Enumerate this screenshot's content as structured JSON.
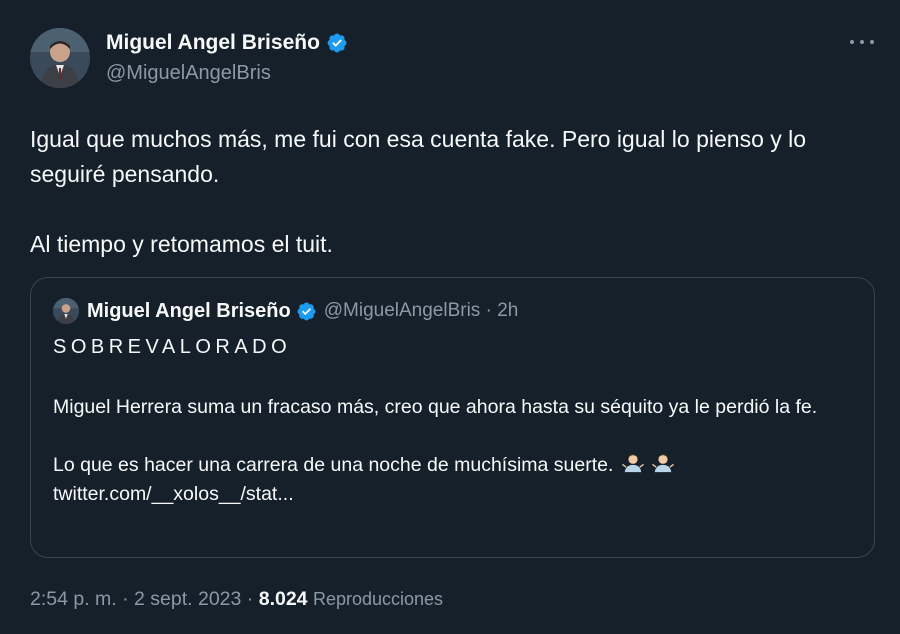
{
  "tweet": {
    "author": {
      "name": "Miguel Angel Briseño",
      "handle": "@MiguelAngelBris"
    },
    "text": {
      "line1": "Igual que muchos más, me fui con esa cuenta fake. Pero igual lo pienso y lo seguiré pensando.",
      "line2": "Al tiempo y retomamos el tuit."
    },
    "quote": {
      "name": "Miguel Angel Briseño",
      "handle_time": "@MiguelAngelBris · 2h",
      "title": "SOBREVALORADO",
      "para1": "Miguel Herrera suma un fracaso más, creo que ahora hasta su séquito ya le perdió la fe.",
      "para2": "Lo que es hacer una carrera de una noche de muchísima suerte.",
      "link": "twitter.com/__xolos__/stat..."
    },
    "footer": {
      "datetime": "2:54 p. m. · 2 sept. 2023 · ",
      "views_count": "8.024",
      "views_label": "Reproducciones"
    }
  },
  "icons": {
    "verified": "verified-badge-icon",
    "more": "more-options-icon",
    "emoji": "man-shrugging-emoji"
  },
  "colors": {
    "background": "#15202b",
    "text": "#f7f9f9",
    "secondary": "#8b98a5",
    "verified": "#1d9bf0",
    "border": "#38444d"
  }
}
